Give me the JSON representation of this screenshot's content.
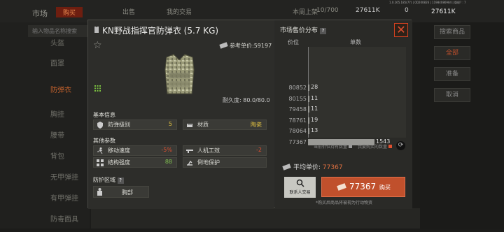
{
  "background": {
    "title": "市场",
    "tabs": [
      "购买",
      "出售",
      "我的交易"
    ],
    "limit_label": "本周上架",
    "limit_value": "10/700",
    "currency": "27611K",
    "badge": "0",
    "currency_main": "27611K",
    "version": "1.0.165.185(77) | 0D200826 | 11984086984 | 版权? : 7",
    "search_placeholder": "输入物品名称搜索",
    "side_items": [
      "头盔",
      "面罩",
      "防弹衣",
      "胸挂",
      "腰带",
      "背包",
      "无甲弹挂",
      "有甲弹挂",
      "防毒面具"
    ],
    "right_buttons": [
      "搜索商品",
      "全部",
      "准备",
      "取消"
    ]
  },
  "item": {
    "title": "KN野战指挥官防弹衣 (5.7 KG)",
    "ref_price_label": "参考单价:",
    "ref_price": "59197",
    "durability_label": "耐久度:",
    "durability": "80.0/80.0",
    "basic_title": "基本信息",
    "basic": [
      {
        "label": "防弹级别",
        "value": "5",
        "color": "#e0c040"
      },
      {
        "label": "材质",
        "value": "陶瓷",
        "color": "#e0c040"
      }
    ],
    "other_title": "其他参数",
    "other": [
      {
        "label": "移动速度",
        "value": "-5%",
        "color": "#e05030"
      },
      {
        "label": "人机工效",
        "value": "-2",
        "color": "#e05030"
      },
      {
        "label": "结构强度",
        "value": "88",
        "color": "#80c050"
      },
      {
        "label": "倒地保护",
        "value": "",
        "color": "#ccc"
      }
    ],
    "protect_title": "防护区域",
    "protect_help": "?",
    "protect_area": "胸部"
  },
  "market": {
    "title": "市场售价分布",
    "help": "?",
    "col_price": "价位",
    "col_count": "单数",
    "prices": [
      "80852",
      "80155",
      "79458",
      "78761",
      "78064",
      "77367"
    ],
    "legend_mine": "当前价位持有数量",
    "legend_shelf": "我要购买的数量",
    "avg_label": "平均单价:",
    "avg_value": "77367",
    "contact_label": "联系人交易",
    "buy_price": "77367",
    "buy_label": "购买",
    "note": "*购买后商品将被视为行动物资"
  },
  "chart_data": {
    "type": "bar",
    "orientation": "horizontal",
    "categories": [
      "80852",
      "80155",
      "79458",
      "78761",
      "78064",
      "77367"
    ],
    "series": [
      {
        "values": [
          28,
          11,
          11,
          19,
          13,
          1543
        ]
      }
    ]
  },
  "colors": {
    "accent": "#c0502c",
    "positive": "#80c050",
    "negative": "#e05030",
    "gold": "#e0c040"
  }
}
